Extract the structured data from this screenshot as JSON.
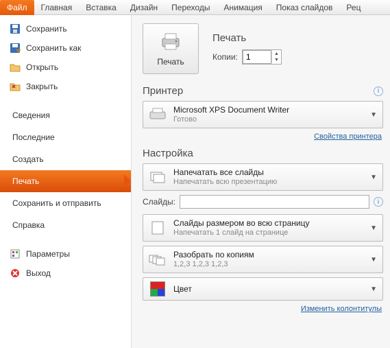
{
  "ribbon": {
    "tabs": [
      "Файл",
      "Главная",
      "Вставка",
      "Дизайн",
      "Переходы",
      "Анимация",
      "Показ слайдов",
      "Рец"
    ]
  },
  "sidebar": {
    "save": "Сохранить",
    "save_as": "Сохранить как",
    "open": "Открыть",
    "close": "Закрыть",
    "info": "Сведения",
    "recent": "Последние",
    "new": "Создать",
    "print": "Печать",
    "share": "Сохранить и отправить",
    "help": "Справка",
    "options": "Параметры",
    "exit": "Выход"
  },
  "print": {
    "heading": "Печать",
    "button": "Печать",
    "copies_label": "Копии:",
    "copies_value": "1"
  },
  "printer": {
    "heading": "Принтер",
    "name": "Microsoft XPS Document Writer",
    "status": "Готово",
    "properties": "Свойства принтера"
  },
  "settings": {
    "heading": "Настройка",
    "all": {
      "title": "Напечатать все слайды",
      "sub": "Напечатать всю презентацию"
    },
    "slides_label": "Слайды:",
    "slides_value": "",
    "full": {
      "title": "Слайды размером во всю страницу",
      "sub": "Напечатать 1 слайд на странице"
    },
    "collate": {
      "title": "Разобрать по копиям",
      "sub": "1,2,3    1,2,3    1,2,3"
    },
    "color": {
      "title": "Цвет"
    },
    "footer": "Изменить колонтитулы"
  }
}
